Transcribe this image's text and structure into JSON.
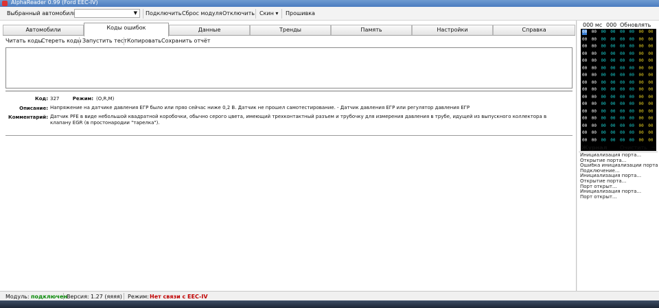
{
  "window": {
    "title": "AlphaReader 0.99 (Ford EEC-IV)"
  },
  "toolbar": {
    "car_label": "Выбранный автомобиль:",
    "car_value": "",
    "connect": "Подключить",
    "reset_module": "Сброс модуля",
    "disconnect": "Отключить",
    "skin": "Скин",
    "firmware": "Прошивка"
  },
  "tabs": [
    "Автомобили",
    "Коды ошибок",
    "Данные",
    "Тренды",
    "Память",
    "Настройки",
    "Справка"
  ],
  "active_tab": 1,
  "subtoolbar": {
    "read": "Читать коды",
    "erase": "Стереть коды",
    "test": "Запустить тест",
    "copy": "Копировать",
    "save": "Сохранить отчёт"
  },
  "details": {
    "code_label": "Код:",
    "code_value": "327",
    "mode_label": "Режим:",
    "mode_value": "(O,R,M)",
    "desc_label": "Описание:",
    "desc_value": "Напряжение на датчике давления ЕГР было или пряо сейчас ниже 0,2 В. Датчик не прошел самотестирование. - Датчик давления ЕГР или регулятор давления ЕГР",
    "comment_label": "Комментарий:",
    "comment_value": "Датчик PFE в виде небольшой квадратной коробочки, обычно серого цвета, имеющий трехконтактный разъем и трубочку для измерения давления в трубе, идущей из выпускного коллектора в клапану EGR (в простонародии \"тарелка\")."
  },
  "right_panel": {
    "time": "000 мс",
    "counter": "000",
    "refresh": "Обновлять",
    "grid_cell_value": "00",
    "grid_rows": 16,
    "grid_cols": 8,
    "grid_highlight_color": "#3a7fd5",
    "grid_text_colors": [
      "#ffffff",
      "#ffffff",
      "#19d0d0",
      "#19d0d0",
      "#19d0d0",
      "#19d0d0",
      "#e8d020",
      "#e8d020"
    ]
  },
  "journal": {
    "title": "Журнал",
    "clear": "Очистить",
    "lines": [
      "Инициализация порта...",
      "Открытие порта...",
      "Ошибка инициализации порта",
      "Подключение...",
      "Инициализация порта...",
      "Открытие порта...",
      "Порт открыт...",
      "Инициализация порта...",
      "Порт открыт..."
    ]
  },
  "status": {
    "module_label": "Модуль:",
    "module_value": "подключен",
    "module_color": "#0a8a0a",
    "version_label": "Версия:",
    "version_value": "1.27 (яяяя)",
    "mode_label": "Режим:",
    "mode_value": "Нет связи с EEC-IV",
    "mode_color": "#c00000"
  }
}
